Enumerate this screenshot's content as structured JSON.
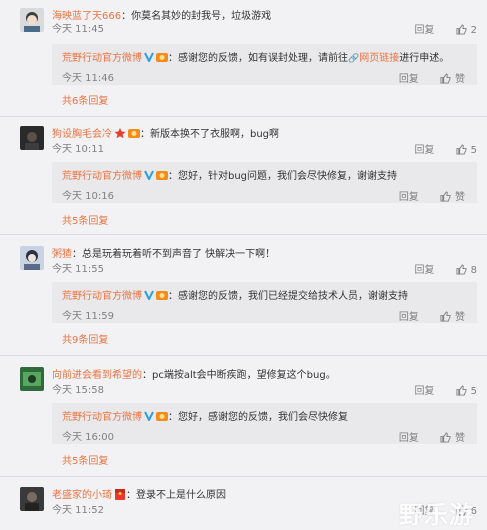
{
  "comments": [
    {
      "username": "海映蓝了天666",
      "text": "你莫名其妙的封我号，垃圾游戏",
      "time": "今天 11:45",
      "reply_label": "回复",
      "likes": "2",
      "avatar": "avatar-boy-illustration",
      "reply": {
        "username": "荒野行动官方微博",
        "text_before_link": "：感谢您的反馈，如有误封处理，请前往",
        "link_text": "网页链接",
        "text_after_link": "进行申述。",
        "time": "今天 11:46",
        "reply_label": "回复",
        "like_label": "赞"
      },
      "more": "共6条回复"
    },
    {
      "username": "狗设胸毛会冷",
      "text": "新版本换不了衣服啊，bug啊",
      "time": "今天 10:11",
      "reply_label": "回复",
      "likes": "5",
      "avatar": "avatar-dark-photo",
      "reply": {
        "username": "荒野行动官方微博",
        "text_before_link": "：您好，针对bug问题，我们会尽快修复，谢谢支持",
        "link_text": "",
        "text_after_link": "",
        "time": "今天 10:16",
        "reply_label": "回复",
        "like_label": "赞"
      },
      "more": "共5条回复"
    },
    {
      "username": "粥猹",
      "text": "总是玩着玩着听不到声音了 快解决一下啊！",
      "time": "今天 11:55",
      "reply_label": "回复",
      "likes": "8",
      "avatar": "avatar-anime-character",
      "reply": {
        "username": "荒野行动官方微博",
        "text_before_link": "：感谢您的反馈，我们已经提交给技术人员，谢谢支持",
        "link_text": "",
        "text_after_link": "",
        "time": "今天 11:59",
        "reply_label": "回复",
        "like_label": "赞"
      },
      "more": "共9条回复"
    },
    {
      "username": "向前进会看到希望的",
      "text": "pc端按alt会中断疾跑，望修复这个bug。",
      "time": "今天 15:58",
      "reply_label": "回复",
      "likes": "5",
      "avatar": "avatar-green-game",
      "reply": {
        "username": "荒野行动官方微博",
        "text_before_link": "：您好，感谢您的反馈，我们会尽快修复",
        "link_text": "",
        "text_after_link": "",
        "time": "今天 16:00",
        "reply_label": "回复",
        "like_label": "赞"
      },
      "more": "共5条回复"
    },
    {
      "username": "老盛家的小琦",
      "text": "登录不上是什么原因",
      "time": "今天 11:52",
      "reply_label": "回复",
      "likes": "6",
      "avatar": "avatar-dark-photo-2"
    }
  ],
  "watermark": "野乐游",
  "colors": {
    "accent": "#eb7340",
    "background": "#f2f2f5",
    "subbox": "#e9e9ec",
    "meta": "#808080"
  }
}
